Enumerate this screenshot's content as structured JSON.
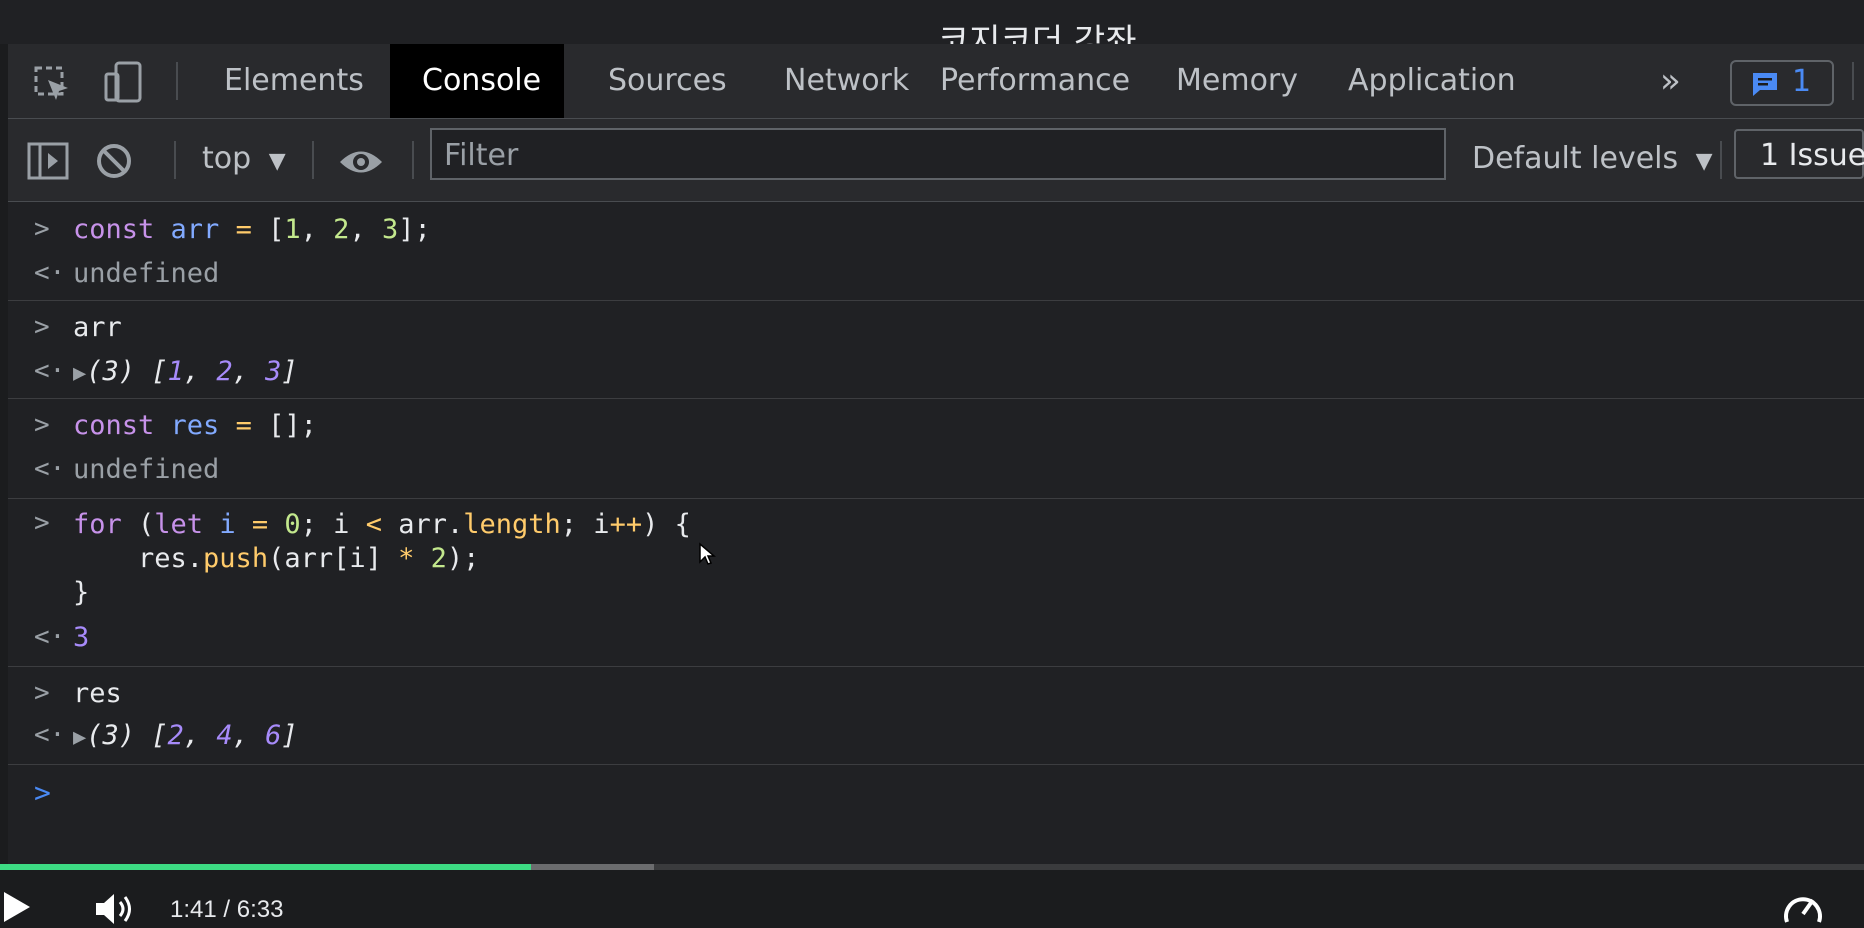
{
  "video": {
    "title": "코지코더 강좌",
    "time_display": "1:41 / 6:33",
    "progress_fraction": 0.285,
    "buffered_fraction": 0.351
  },
  "devtools": {
    "tabs": [
      {
        "label": "Elements",
        "active": false
      },
      {
        "label": "Console",
        "active": true
      },
      {
        "label": "Sources",
        "active": false
      },
      {
        "label": "Network",
        "active": false
      },
      {
        "label": "Performance",
        "active": false
      },
      {
        "label": "Memory",
        "active": false
      },
      {
        "label": "Application",
        "active": false
      }
    ],
    "more_tabs": "»",
    "message_count": "1",
    "toolbar": {
      "context": "top",
      "filter_placeholder": "Filter",
      "levels": "Default levels",
      "issues": "1 Issue"
    },
    "accent": "#4a8af4"
  },
  "console": {
    "entries": [
      {
        "input": "const arr = [1, 2, 3];",
        "output": "undefined"
      },
      {
        "input": "arr",
        "output": "(3) [1, 2, 3]"
      },
      {
        "input": "const res = [];",
        "output": "undefined"
      },
      {
        "input": "for (let i = 0; i < arr.length; i++) {\n    res.push(arr[i] * 2);\n}",
        "output": "3"
      },
      {
        "input": "res",
        "output": "(3) [2, 4, 6]"
      }
    ]
  }
}
